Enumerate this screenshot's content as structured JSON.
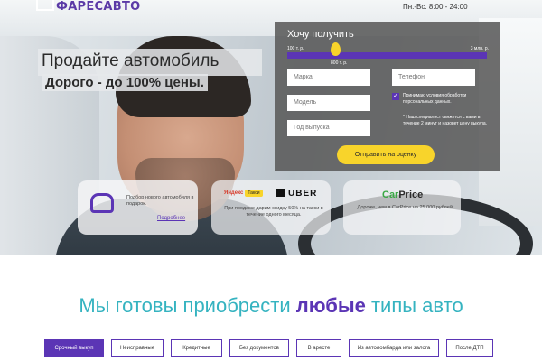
{
  "header": {
    "logo": "ФАРЕСАВТО",
    "hours": "Пн.-Вс. 8:00 - 24:00"
  },
  "hero": {
    "title": "Продайте автомобиль",
    "subtitle": "Дорого - до 100% цены."
  },
  "form": {
    "title": "Хочу получить",
    "range_min": "100 т. р.",
    "range_max": "3 млн. р.",
    "slider_value": "800 т. р.",
    "slider_fraction": 0.24,
    "brand_placeholder": "Марка",
    "phone_placeholder": "Телефон",
    "model_placeholder": "Модель",
    "year_placeholder": "Год выпуска",
    "consent_checked": true,
    "consent_text": "Принимаю условия обработки персональных данных.",
    "note": "* Наш специалист свяжется с вами в течение 2 минут и назовет цену выкупа.",
    "submit_label": "Отправить на оценку"
  },
  "cards": {
    "card1": {
      "icon": "car-search-icon",
      "text": "Подбор нового автомобиля в подарок.",
      "link": "Подробнее"
    },
    "card2": {
      "yandex": "Яндекс",
      "yandex_tag": "Такси",
      "uber": "UBER",
      "text": "При продаже дарим скидку 50% на такси в течение одного месяца."
    },
    "card3": {
      "brand_a": "Car",
      "brand_b": "Price",
      "text": "Дороже, чем в CarPrice на 25 000 рублей."
    }
  },
  "section": {
    "title_before": "Мы готовы приобрести ",
    "title_bold": "любые",
    "title_after": " типы авто"
  },
  "tabs": [
    {
      "label": "Срочный выкуп",
      "active": true
    },
    {
      "label": "Неисправные",
      "active": false
    },
    {
      "label": "Кредитные",
      "active": false
    },
    {
      "label": "Без документов",
      "active": false
    },
    {
      "label": "В аресте",
      "active": false
    },
    {
      "label": "Из автоломбарда или залога",
      "active": false
    },
    {
      "label": "После ДТП",
      "active": false
    }
  ],
  "colors": {
    "accent": "#5b35b5",
    "button": "#f8d42b",
    "heading_teal": "#35b3c0"
  }
}
